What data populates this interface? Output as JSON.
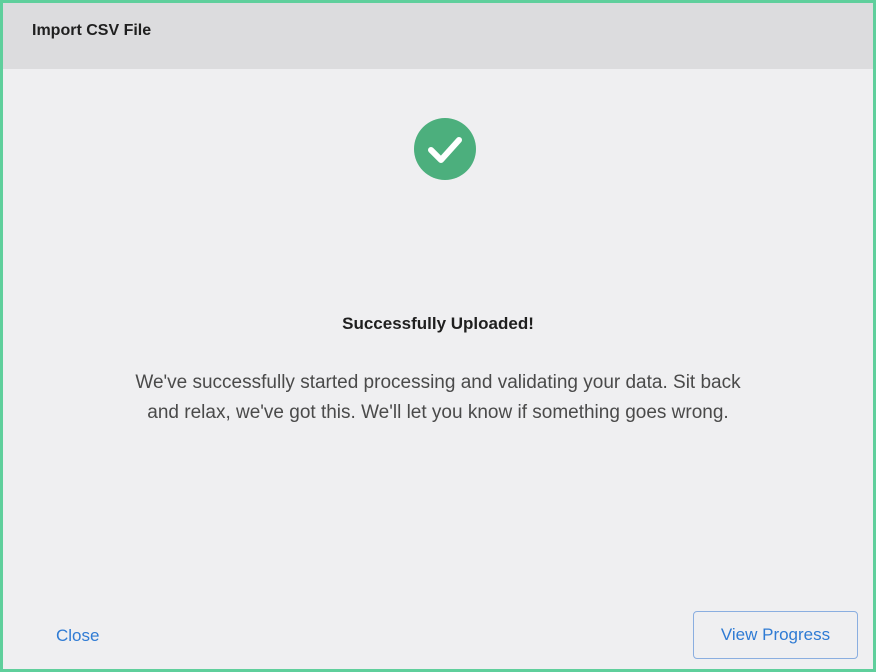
{
  "dialog": {
    "title": "Import CSV File",
    "success_icon": "check-circle-icon",
    "success_title": "Successfully Uploaded!",
    "success_message": "We've successfully started processing and validating your data. Sit back and relax, we've got this. We'll let you know if something goes wrong.",
    "close_label": "Close",
    "view_progress_label": "View Progress"
  },
  "colors": {
    "border": "#5fcf9c",
    "success_green": "#4caf7d",
    "link_blue": "#2f7bd4",
    "header_bg": "#dcdcde",
    "body_bg": "#efeff1"
  }
}
